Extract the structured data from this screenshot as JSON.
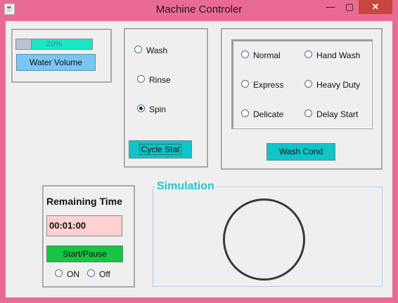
{
  "window": {
    "title": "Machine Controler",
    "app_icon": "java-icon",
    "controls": {
      "minimize": "—",
      "maximize": "▢",
      "close": "✕"
    }
  },
  "water": {
    "progress_percent": 20,
    "progress_label": "20%",
    "button_label": "Water Volume"
  },
  "cycle": {
    "options": [
      {
        "label": "Wash",
        "selected": false
      },
      {
        "label": "Rinse",
        "selected": false
      },
      {
        "label": "Spin",
        "selected": true
      }
    ],
    "button_label": "Cycle Stat"
  },
  "wash_conditions": {
    "options": [
      {
        "label": "Normal",
        "selected": false
      },
      {
        "label": "Hand Wash",
        "selected": false
      },
      {
        "label": "Express",
        "selected": false
      },
      {
        "label": "Heavy Duty",
        "selected": false
      },
      {
        "label": "Delicate",
        "selected": false
      },
      {
        "label": "Delay Start",
        "selected": false
      }
    ],
    "button_label": "Wash Cond"
  },
  "timer": {
    "title": "Remaining Time",
    "value": "00:01:00",
    "start_pause_label": "Start/Pause",
    "power_options": [
      {
        "label": "ON",
        "selected": false
      },
      {
        "label": "Off",
        "selected": false
      }
    ]
  },
  "simulation": {
    "title": "Simulation"
  },
  "colors": {
    "window_frame": "#e96b95",
    "close_button": "#c9463d",
    "progress_fill": "#19e8c4",
    "water_button": "#79c6f2",
    "cyan_button": "#10c4c7",
    "start_button": "#18c345",
    "time_field": "#ffd0d0",
    "simulation_title": "#1ec8cc"
  }
}
